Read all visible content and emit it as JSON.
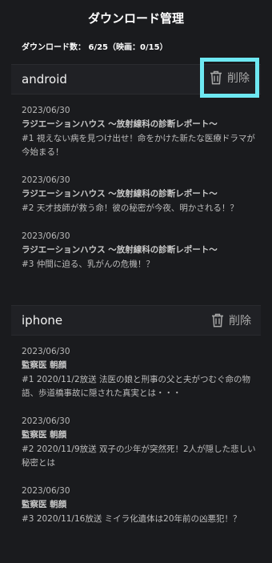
{
  "page": {
    "title": "ダウンロード管理",
    "count_label": "ダウンロード数：",
    "count_value": "6/25（映画：0/15）"
  },
  "delete_label": "削除",
  "devices": [
    {
      "name": "android",
      "episodes": [
        {
          "date": "2023/06/30",
          "title": "ラジエーションハウス 〜放射線科の診断レポート〜",
          "desc": "#1 視えない病を見つけ出せ！命をかけた新たな医療ドラマが今始まる！"
        },
        {
          "date": "2023/06/30",
          "title": "ラジエーションハウス 〜放射線科の診断レポート〜",
          "desc": "#2 天才技師が救う命！彼の秘密が今夜、明かされる！？"
        },
        {
          "date": "2023/06/30",
          "title": "ラジエーションハウス 〜放射線科の診断レポート〜",
          "desc": "#3 仲間に迫る、乳がんの危機！？"
        }
      ]
    },
    {
      "name": "iphone",
      "episodes": [
        {
          "date": "2023/06/30",
          "title": "監察医 朝顔",
          "desc": "#1 2020/11/2放送 法医の娘と刑事の父と夫がつむぐ命の物語、歩道橋事故に隠された真実とは・・・"
        },
        {
          "date": "2023/06/30",
          "title": "監察医 朝顔",
          "desc": "#2 2020/11/9放送 双子の少年が突然死！2人が隠した悲しい秘密とは"
        },
        {
          "date": "2023/06/30",
          "title": "監察医 朝顔",
          "desc": "#3 2020/11/16放送 ミイラ化遺体は20年前の凶悪犯！？"
        }
      ]
    }
  ],
  "colors": {
    "background": "#1a1b1e",
    "header_bg": "#202125",
    "highlight_border": "#6ee8f2"
  }
}
